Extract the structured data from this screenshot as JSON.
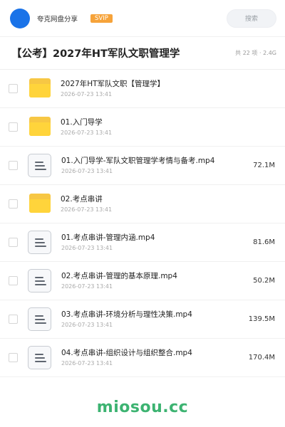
{
  "header": {
    "user_name": "夸克网盘分享",
    "badge": "SVIP",
    "search_placeholder": "搜索"
  },
  "folder": {
    "title": "【公考】2027年HT军队文职管理学",
    "meta": "共 22 项 · 2.4G"
  },
  "items": [
    {
      "type": "folder",
      "icon": "folder-icon",
      "name": "2027年HT军队文职【管理学】",
      "date": "2026-07-23 13:41",
      "size": ""
    },
    {
      "type": "folder",
      "icon": "folder-icon",
      "name": "01.入门导学",
      "date": "2026-07-23 13:41",
      "size": ""
    },
    {
      "type": "file",
      "icon": "document-icon",
      "name": "01.入门导学-军队文职管理学考情与备考.mp4",
      "date": "2026-07-23 13:41",
      "size": "72.1M"
    },
    {
      "type": "folder",
      "icon": "folder-icon",
      "name": "02.考点串讲",
      "date": "2026-07-23 13:41",
      "size": ""
    },
    {
      "type": "file",
      "icon": "document-icon",
      "name": "01.考点串讲-管理内涵.mp4",
      "date": "2026-07-23 13:41",
      "size": "81.6M"
    },
    {
      "type": "file",
      "icon": "document-icon",
      "name": "02.考点串讲-管理的基本原理.mp4",
      "date": "2026-07-23 13:41",
      "size": "50.2M"
    },
    {
      "type": "file",
      "icon": "document-icon",
      "name": "03.考点串讲-环境分析与理性决策.mp4",
      "date": "2026-07-23 13:41",
      "size": "139.5M"
    },
    {
      "type": "file",
      "icon": "document-icon",
      "name": "04.考点串讲-组织设计与组织整合.mp4",
      "date": "2026-07-23 13:41",
      "size": "170.4M"
    }
  ],
  "watermark": "miosou.cc",
  "colors": {
    "avatar": "#1a73e8",
    "badge": "#f6a33a",
    "folder": "#ffd43b",
    "watermark": "#3cb371"
  }
}
